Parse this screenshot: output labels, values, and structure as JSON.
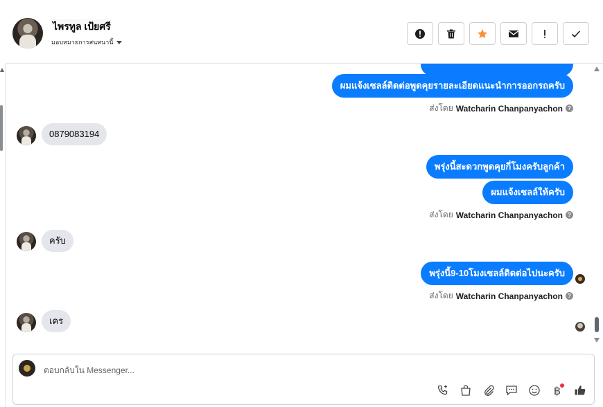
{
  "header": {
    "contact_name": "ไพรทูล เป้ยศรี",
    "assign_label": "มอบหมายการสนทนานี้"
  },
  "actions": [
    {
      "name": "spam-button",
      "icon": "alert-circle-icon"
    },
    {
      "name": "delete-button",
      "icon": "trash-icon"
    },
    {
      "name": "star-button",
      "icon": "star-icon"
    },
    {
      "name": "mark-unread-button",
      "icon": "envelope-icon"
    },
    {
      "name": "follow-up-button",
      "icon": "exclamation-icon"
    },
    {
      "name": "done-button",
      "icon": "check-icon"
    }
  ],
  "colors": {
    "outgoing_bubble": "#0a7cff",
    "incoming_bubble": "#e4e6eb",
    "star": "#f7923a"
  },
  "messages": {
    "out1": "ผมแจ้งเซลล์ติดต่อพูดคุยรายละเอียดแนะนำการออกรถครับ",
    "sent_label": "ส่งโดย",
    "sender": "Watcharin Chanpanyachon",
    "in1": "0879083194",
    "out2": "พรุ่งนี้สะดวกพูดคุยกี่โมงครับลูกค้า",
    "out3": "ผมแจ้งเซลล์ให้ครับ",
    "in2": "ครับ",
    "out4": "พรุ่งนี้9-10โมงเซลล์ติดต่อไปนะครับ",
    "in3": "เคร"
  },
  "composer": {
    "placeholder": "ตอบกลับใน Messenger...",
    "baht_symbol": "฿"
  }
}
